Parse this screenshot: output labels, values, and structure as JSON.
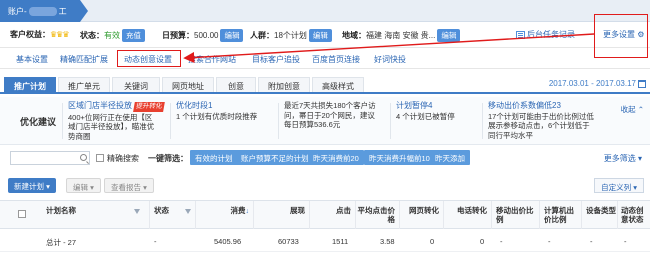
{
  "account": {
    "tab_label_prefix": "账户-",
    "tab_label_suffix": "工"
  },
  "info": {
    "customer_rights_label": "客户权益：",
    "crowns": "♛♛♛",
    "status_label": "状态：",
    "status_value": "有效",
    "recharge_btn": "充值",
    "daily_budget_label": "日预算：",
    "daily_budget_value": "500.00",
    "edit1": "编辑",
    "people_label": "人群：",
    "people_value": "18个计划",
    "edit2": "编辑",
    "region_label": "地域：",
    "region_value": "福建 海南 安徽 贵...",
    "edit3": "编辑",
    "task_record": "后台任务记录",
    "more_settings": "更多设置"
  },
  "links": {
    "basic_settings": "基本设置",
    "exact_match": "精确匹配扩展",
    "auto_bid": "动态创意设置",
    "search_partner": "搜索合作网站",
    "target_people": "目标客户追投",
    "baidu_home": "百度首页连接",
    "good_sentence": "好词快投"
  },
  "tabs": [
    {
      "label": "推广计划",
      "active": true
    },
    {
      "label": "推广单元",
      "active": false
    },
    {
      "label": "关键词",
      "active": false
    },
    {
      "label": "网页地址",
      "active": false
    },
    {
      "label": "创意",
      "active": false
    },
    {
      "label": "附加创意",
      "active": false
    },
    {
      "label": "高级样式",
      "active": false
    }
  ],
  "date_range": "2017.03.01 - 2017.03.17",
  "optimization": {
    "title": "优化建议",
    "collapse": "收起",
    "items": [
      {
        "heading": "区域门店半径投放",
        "badge": "提升转化",
        "line1": "400+位网行正在使用【区",
        "line2": "域门店半径投放】，瞄准优",
        "line3": "势商圈"
      },
      {
        "heading": "优化时段1",
        "line1": "1 个计划有优质时段推荐",
        "line2": "",
        "line3": ""
      },
      {
        "heading": "",
        "line1": "最近7天共损失180个客户访",
        "line2": "问，幂日于20个网民，建议",
        "line3": "每日预算536.6元"
      },
      {
        "heading": "计划暂停4",
        "line1": "4 个计划已被暂停",
        "line2": "",
        "line3": ""
      },
      {
        "heading": "移动出价系数偏低23",
        "line1": "17个计划可能由于出价比例过低",
        "line2": "展示参移动点击，6个计划低于",
        "line3": "同行平均水平"
      }
    ]
  },
  "filters": {
    "precise_search": "精确搜索",
    "quick_filter": "一键筛选：",
    "chips": [
      "有效的计划",
      "账户预算不足的计划",
      "昨天消费前20",
      "昨天消费升幅前10",
      "昨天添加"
    ],
    "more_filter": "更多筛选"
  },
  "actions": {
    "new_plan": "新建计划",
    "edit": "编辑",
    "view_report": "查看报告",
    "custom_columns": "自定义列"
  },
  "table": {
    "headers": [
      "计划名称",
      "状态",
      "消费",
      "展现",
      "点击",
      "平均点击价格",
      "网页转化",
      "电话转化",
      "移动出价比例",
      "计算机出价比例",
      "设备类型",
      "动态创意状态"
    ],
    "total_row": [
      "总计 - 27",
      "-",
      "5405.96",
      "60733",
      "1511",
      "3.58",
      "0",
      "0",
      "-",
      "-",
      "-",
      "-"
    ]
  },
  "colors": {
    "accent": "#3f7cc6",
    "link": "#2a65b3",
    "highlight_red": "#e01b1b"
  }
}
